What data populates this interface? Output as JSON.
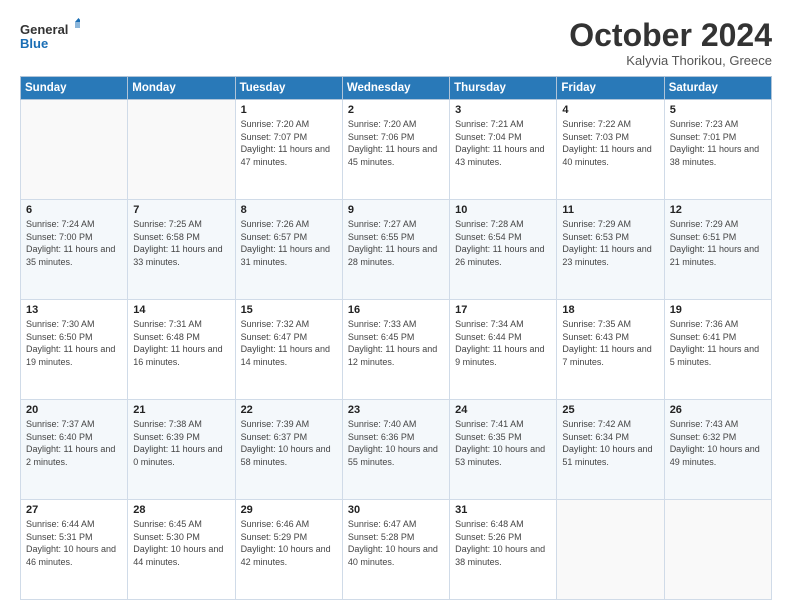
{
  "logo": {
    "line1": "General",
    "line2": "Blue"
  },
  "title": "October 2024",
  "subtitle": "Kalyvia Thorikou, Greece",
  "days_of_week": [
    "Sunday",
    "Monday",
    "Tuesday",
    "Wednesday",
    "Thursday",
    "Friday",
    "Saturday"
  ],
  "weeks": [
    [
      {
        "day": "",
        "info": ""
      },
      {
        "day": "",
        "info": ""
      },
      {
        "day": "1",
        "info": "Sunrise: 7:20 AM\nSunset: 7:07 PM\nDaylight: 11 hours and 47 minutes."
      },
      {
        "day": "2",
        "info": "Sunrise: 7:20 AM\nSunset: 7:06 PM\nDaylight: 11 hours and 45 minutes."
      },
      {
        "day": "3",
        "info": "Sunrise: 7:21 AM\nSunset: 7:04 PM\nDaylight: 11 hours and 43 minutes."
      },
      {
        "day": "4",
        "info": "Sunrise: 7:22 AM\nSunset: 7:03 PM\nDaylight: 11 hours and 40 minutes."
      },
      {
        "day": "5",
        "info": "Sunrise: 7:23 AM\nSunset: 7:01 PM\nDaylight: 11 hours and 38 minutes."
      }
    ],
    [
      {
        "day": "6",
        "info": "Sunrise: 7:24 AM\nSunset: 7:00 PM\nDaylight: 11 hours and 35 minutes."
      },
      {
        "day": "7",
        "info": "Sunrise: 7:25 AM\nSunset: 6:58 PM\nDaylight: 11 hours and 33 minutes."
      },
      {
        "day": "8",
        "info": "Sunrise: 7:26 AM\nSunset: 6:57 PM\nDaylight: 11 hours and 31 minutes."
      },
      {
        "day": "9",
        "info": "Sunrise: 7:27 AM\nSunset: 6:55 PM\nDaylight: 11 hours and 28 minutes."
      },
      {
        "day": "10",
        "info": "Sunrise: 7:28 AM\nSunset: 6:54 PM\nDaylight: 11 hours and 26 minutes."
      },
      {
        "day": "11",
        "info": "Sunrise: 7:29 AM\nSunset: 6:53 PM\nDaylight: 11 hours and 23 minutes."
      },
      {
        "day": "12",
        "info": "Sunrise: 7:29 AM\nSunset: 6:51 PM\nDaylight: 11 hours and 21 minutes."
      }
    ],
    [
      {
        "day": "13",
        "info": "Sunrise: 7:30 AM\nSunset: 6:50 PM\nDaylight: 11 hours and 19 minutes."
      },
      {
        "day": "14",
        "info": "Sunrise: 7:31 AM\nSunset: 6:48 PM\nDaylight: 11 hours and 16 minutes."
      },
      {
        "day": "15",
        "info": "Sunrise: 7:32 AM\nSunset: 6:47 PM\nDaylight: 11 hours and 14 minutes."
      },
      {
        "day": "16",
        "info": "Sunrise: 7:33 AM\nSunset: 6:45 PM\nDaylight: 11 hours and 12 minutes."
      },
      {
        "day": "17",
        "info": "Sunrise: 7:34 AM\nSunset: 6:44 PM\nDaylight: 11 hours and 9 minutes."
      },
      {
        "day": "18",
        "info": "Sunrise: 7:35 AM\nSunset: 6:43 PM\nDaylight: 11 hours and 7 minutes."
      },
      {
        "day": "19",
        "info": "Sunrise: 7:36 AM\nSunset: 6:41 PM\nDaylight: 11 hours and 5 minutes."
      }
    ],
    [
      {
        "day": "20",
        "info": "Sunrise: 7:37 AM\nSunset: 6:40 PM\nDaylight: 11 hours and 2 minutes."
      },
      {
        "day": "21",
        "info": "Sunrise: 7:38 AM\nSunset: 6:39 PM\nDaylight: 11 hours and 0 minutes."
      },
      {
        "day": "22",
        "info": "Sunrise: 7:39 AM\nSunset: 6:37 PM\nDaylight: 10 hours and 58 minutes."
      },
      {
        "day": "23",
        "info": "Sunrise: 7:40 AM\nSunset: 6:36 PM\nDaylight: 10 hours and 55 minutes."
      },
      {
        "day": "24",
        "info": "Sunrise: 7:41 AM\nSunset: 6:35 PM\nDaylight: 10 hours and 53 minutes."
      },
      {
        "day": "25",
        "info": "Sunrise: 7:42 AM\nSunset: 6:34 PM\nDaylight: 10 hours and 51 minutes."
      },
      {
        "day": "26",
        "info": "Sunrise: 7:43 AM\nSunset: 6:32 PM\nDaylight: 10 hours and 49 minutes."
      }
    ],
    [
      {
        "day": "27",
        "info": "Sunrise: 6:44 AM\nSunset: 5:31 PM\nDaylight: 10 hours and 46 minutes."
      },
      {
        "day": "28",
        "info": "Sunrise: 6:45 AM\nSunset: 5:30 PM\nDaylight: 10 hours and 44 minutes."
      },
      {
        "day": "29",
        "info": "Sunrise: 6:46 AM\nSunset: 5:29 PM\nDaylight: 10 hours and 42 minutes."
      },
      {
        "day": "30",
        "info": "Sunrise: 6:47 AM\nSunset: 5:28 PM\nDaylight: 10 hours and 40 minutes."
      },
      {
        "day": "31",
        "info": "Sunrise: 6:48 AM\nSunset: 5:26 PM\nDaylight: 10 hours and 38 minutes."
      },
      {
        "day": "",
        "info": ""
      },
      {
        "day": "",
        "info": ""
      }
    ]
  ]
}
